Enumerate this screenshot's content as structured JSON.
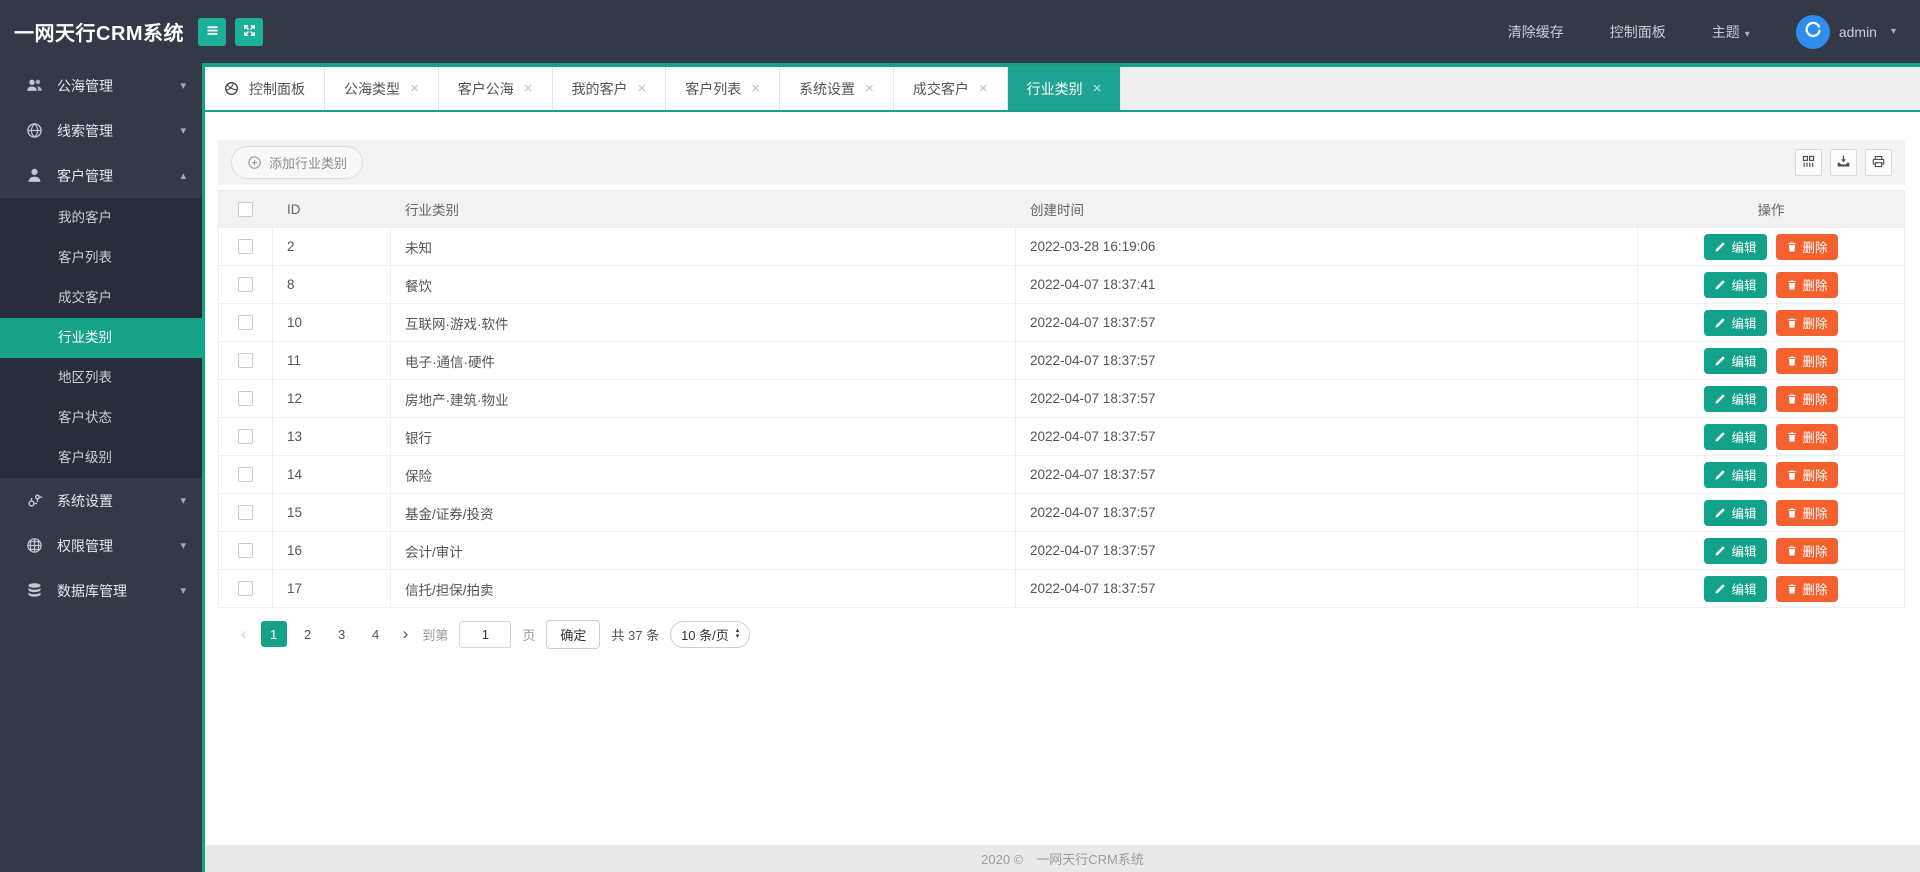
{
  "app": {
    "title": "一网天行CRM系统"
  },
  "header": {
    "clear_cache": "清除缓存",
    "control_panel": "控制面板",
    "theme": "主题",
    "user": "admin"
  },
  "sidebar": {
    "items": [
      {
        "label": "公海管理",
        "icon": "users-icon",
        "caret": "down"
      },
      {
        "label": "线索管理",
        "icon": "globe-icon",
        "caret": "down"
      },
      {
        "label": "客户管理",
        "icon": "user-icon",
        "caret": "up",
        "expanded": true,
        "children": [
          {
            "label": "我的客户"
          },
          {
            "label": "客户列表"
          },
          {
            "label": "成交客户"
          },
          {
            "label": "行业类别",
            "active": true
          },
          {
            "label": "地区列表"
          },
          {
            "label": "客户状态"
          },
          {
            "label": "客户级别"
          }
        ]
      },
      {
        "label": "系统设置",
        "icon": "cogs-icon",
        "caret": "down"
      },
      {
        "label": "权限管理",
        "icon": "globe-grid-icon",
        "caret": "down"
      },
      {
        "label": "数据库管理",
        "icon": "database-icon",
        "caret": "down"
      }
    ]
  },
  "tabs": [
    {
      "label": "控制面板",
      "icon": "dashboard-icon",
      "closable": false
    },
    {
      "label": "公海类型",
      "closable": true
    },
    {
      "label": "客户公海",
      "closable": true
    },
    {
      "label": "我的客户",
      "closable": true
    },
    {
      "label": "客户列表",
      "closable": true
    },
    {
      "label": "系统设置",
      "closable": true
    },
    {
      "label": "成交客户",
      "closable": true
    },
    {
      "label": "行业类别",
      "closable": true,
      "active": true
    }
  ],
  "toolbar": {
    "add_label": "添加行业类别"
  },
  "table": {
    "columns": [
      "ID",
      "行业类别",
      "创建时间",
      "操作"
    ],
    "edit_label": "编辑",
    "delete_label": "删除",
    "rows": [
      {
        "id": "2",
        "category": "未知",
        "created": "2022-03-28 16:19:06"
      },
      {
        "id": "8",
        "category": "餐饮",
        "created": "2022-04-07 18:37:41"
      },
      {
        "id": "10",
        "category": "互联网·游戏·软件",
        "created": "2022-04-07 18:37:57"
      },
      {
        "id": "11",
        "category": "电子·通信·硬件",
        "created": "2022-04-07 18:37:57"
      },
      {
        "id": "12",
        "category": "房地产·建筑·物业",
        "created": "2022-04-07 18:37:57"
      },
      {
        "id": "13",
        "category": "银行",
        "created": "2022-04-07 18:37:57"
      },
      {
        "id": "14",
        "category": "保险",
        "created": "2022-04-07 18:37:57"
      },
      {
        "id": "15",
        "category": "基金/证券/投资",
        "created": "2022-04-07 18:37:57"
      },
      {
        "id": "16",
        "category": "会计/审计",
        "created": "2022-04-07 18:37:57"
      },
      {
        "id": "17",
        "category": "信托/担保/拍卖",
        "created": "2022-04-07 18:37:57"
      }
    ]
  },
  "pagination": {
    "pages": [
      "1",
      "2",
      "3",
      "4"
    ],
    "active_page": "1",
    "goto_label": "到第",
    "goto_value": "1",
    "page_label": "页",
    "confirm_label": "确定",
    "total_label": "共 37 条",
    "page_size": "10 条/页"
  },
  "footer": {
    "text": "2020 ©　一网天行CRM系统"
  },
  "colors": {
    "accent_teal": "#16A287",
    "accent_teal_bright": "#1CB09A",
    "header_bg": "#333946",
    "submenu_bg": "#282E39",
    "delete_orange": "#F4612E",
    "avatar_blue": "#2E8DEF",
    "tabbar_bg": "#EFEFEF",
    "footer_bg": "#E9E9E9"
  }
}
